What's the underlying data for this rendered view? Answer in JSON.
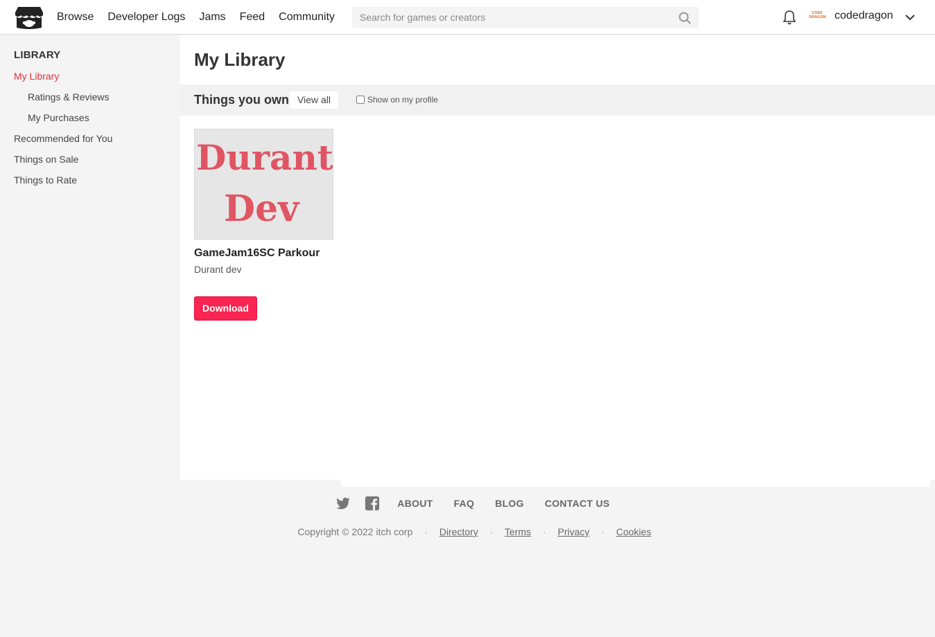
{
  "header": {
    "nav": [
      {
        "label": "Browse"
      },
      {
        "label": "Developer Logs"
      },
      {
        "label": "Jams"
      },
      {
        "label": "Feed"
      },
      {
        "label": "Community"
      }
    ],
    "search_placeholder": "Search for games or creators",
    "avatar_text": "CODE DRAGON",
    "username": "codedragon"
  },
  "sidebar": {
    "heading": "LIBRARY",
    "items": [
      {
        "label": "My Library",
        "active": true
      },
      {
        "label": "Ratings & Reviews"
      },
      {
        "label": "My Purchases"
      },
      {
        "label": "Recommended for You"
      },
      {
        "label": "Things on Sale"
      },
      {
        "label": "Things to Rate"
      }
    ]
  },
  "main": {
    "title": "My Library",
    "owned": {
      "title": "Things you own",
      "view_all": "View all",
      "show_profile": "Show on my profile"
    },
    "games": [
      {
        "thumb_text_1": "Durant",
        "thumb_text_2": "Dev",
        "title": "GameJam16SC Parkour",
        "author": "Durant dev",
        "download": "Download"
      }
    ]
  },
  "footer": {
    "links": [
      "ABOUT",
      "FAQ",
      "BLOG",
      "CONTACT US"
    ],
    "copyright": "Copyright © 2022 itch corp",
    "legal": [
      "Directory",
      "Terms",
      "Privacy",
      "Cookies"
    ]
  },
  "colors": {
    "accent": "#fa2551",
    "active_link": "#e0303a",
    "thumb_text": "#e05563"
  }
}
